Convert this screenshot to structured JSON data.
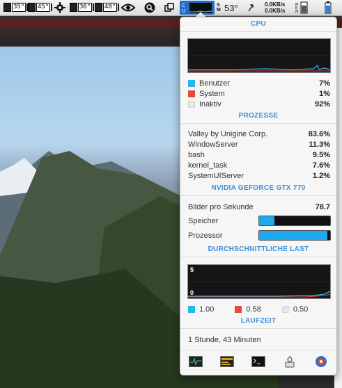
{
  "menubar": {
    "temps": [
      "35°",
      "45°",
      "36°",
      "48°"
    ],
    "cpu_temp": "53°",
    "net_up": "0.0KB/s",
    "net_down": "0.0KB/s",
    "icons": [
      "temperature-sensor-icon",
      "gear-icon",
      "nvidia-icon",
      "spotlight-search-icon",
      "window-icon",
      "cpu-menu-icon",
      "memory-icon",
      "battery-icon"
    ]
  },
  "panel": {
    "cpu_title": "CPU",
    "cpu_rows": [
      {
        "label": "Benutzer",
        "value": "7%",
        "color": "#2bb5ef"
      },
      {
        "label": "System",
        "value": "1%",
        "color": "#e8493a"
      },
      {
        "label": "Inaktiv",
        "value": "92%",
        "color": "#e8e8e8"
      }
    ],
    "processes_title": "PROZESSE",
    "processes": [
      {
        "name": "Valley by Unigine Corp.",
        "value": "83.6%"
      },
      {
        "name": "WindowServer",
        "value": "11.3%"
      },
      {
        "name": "bash",
        "value": "9.5%"
      },
      {
        "name": "kernel_task",
        "value": "7.6%"
      },
      {
        "name": "SystemUIServer",
        "value": "1.2%"
      }
    ],
    "gpu_title": "NVIDIA GEFORCE GTX 770",
    "fps_label": "Bilder pro Sekunde",
    "fps_value": "78.7",
    "memory_label": "Speicher",
    "memory_fraction": 0.22,
    "processor_label": "Prozessor",
    "processor_fraction": 0.96,
    "load_title": "DURCHSCHNITTLICHE LAST",
    "load_graph_max": "5",
    "load_graph_min": "0",
    "load_values": [
      {
        "value": "1.00",
        "color": "#2bb5ef"
      },
      {
        "value": "0.58",
        "color": "#e8493a"
      },
      {
        "value": "0.50",
        "color": "#e8e8e8"
      }
    ],
    "uptime_title": "LAUFZEIT",
    "uptime_value": "1 Stunde, 43 Minuten",
    "toolbar_icons": [
      "activity-monitor-icon",
      "console-icon",
      "terminal-icon",
      "system-information-icon",
      "disk-utility-icon"
    ]
  }
}
